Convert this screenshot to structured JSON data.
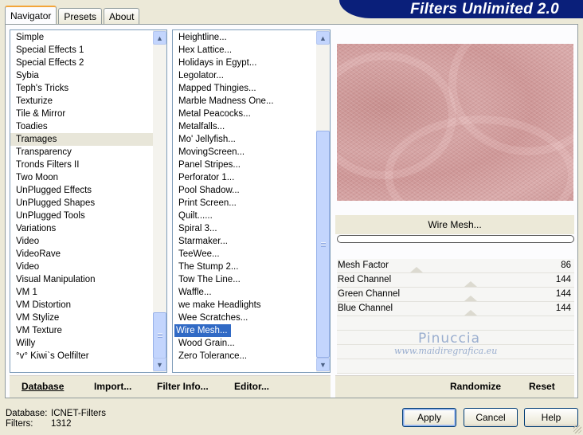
{
  "tabs": [
    "Navigator",
    "Presets",
    "About"
  ],
  "app_title": "Filters Unlimited 2.0",
  "categories": [
    "Simple",
    "Special Effects 1",
    "Special Effects 2",
    "Sybia",
    "Teph's Tricks",
    "Texturize",
    "Tile & Mirror",
    "Toadies",
    "Tramages",
    "Transparency",
    "Tronds Filters II",
    "Two Moon",
    "UnPlugged Effects",
    "UnPlugged Shapes",
    "UnPlugged Tools",
    "Variations",
    "Video",
    "VideoRave",
    "Video",
    "Visual Manipulation",
    "VM 1",
    "VM Distortion",
    "VM Stylize",
    "VM Texture",
    "Willy",
    "°v° Kiwi`s Oelfilter"
  ],
  "selected_category": "Tramages",
  "filters": [
    "Heightline...",
    "Hex Lattice...",
    "Holidays in Egypt...",
    "Legolator...",
    "Mapped Thingies...",
    "Marble Madness One...",
    "Metal Peacocks...",
    "Metalfalls...",
    "Mo' Jellyfish...",
    "MovingScreen...",
    "Panel Stripes...",
    "Perforator 1...",
    "Pool Shadow...",
    "Print Screen...",
    "Quilt......",
    "Spiral 3...",
    "Starmaker...",
    "TeeWee...",
    "The Stump 2...",
    "Tow The Line...",
    "Waffle...",
    "we make Headlights",
    "Wee Scratches...",
    "Wire Mesh...",
    "Wood Grain...",
    "Zero Tolerance..."
  ],
  "selected_filter": "Wire Mesh...",
  "current_filter_name": "Wire Mesh...",
  "parameters": [
    {
      "label": "Mesh Factor",
      "value": "86"
    },
    {
      "label": "Red Channel",
      "value": "144"
    },
    {
      "label": "Green Channel",
      "value": "144"
    },
    {
      "label": "Blue Channel",
      "value": "144"
    }
  ],
  "watermark": {
    "name": "Pinuccia",
    "url": "www.maidiregrafica.eu"
  },
  "bottom_buttons": {
    "database": "Database",
    "import": "Import...",
    "filter_info": "Filter Info...",
    "editor": "Editor...",
    "randomize": "Randomize",
    "reset": "Reset"
  },
  "footer": {
    "database_label": "Database:",
    "database_value": "ICNET-Filters",
    "filters_label": "Filters:",
    "filters_value": "1312"
  },
  "dialog_buttons": {
    "apply": "Apply",
    "cancel": "Cancel",
    "help": "Help"
  },
  "colors": {
    "banner": "#0a1f7a",
    "selection": "#316ac5",
    "preview_tint": "#d6a5a5"
  }
}
